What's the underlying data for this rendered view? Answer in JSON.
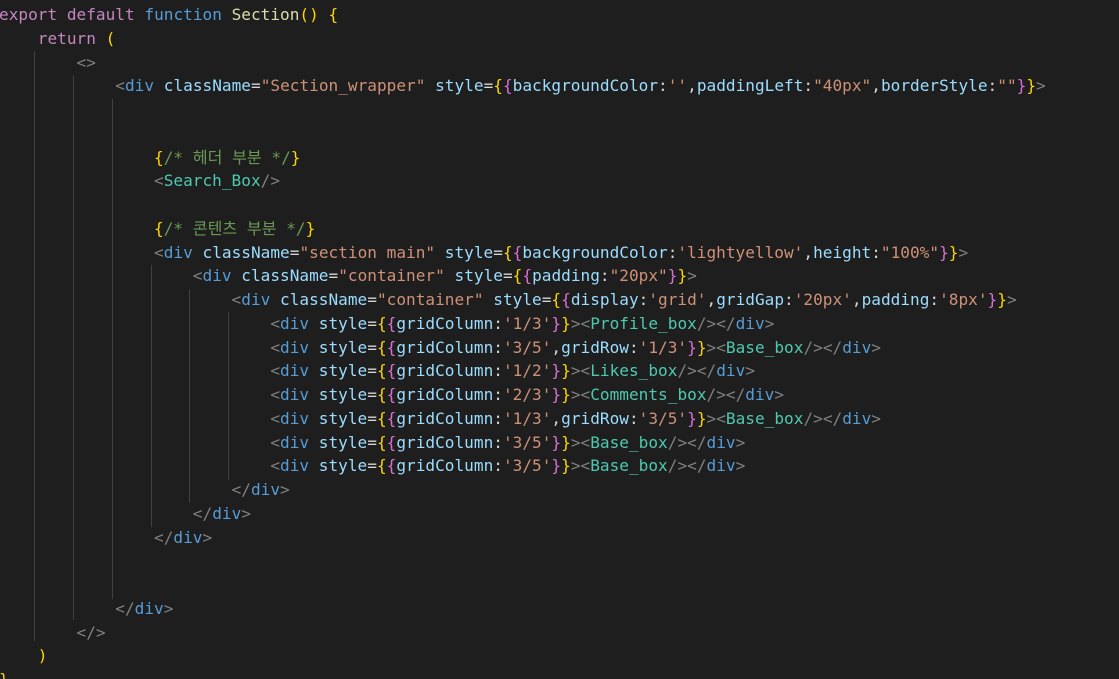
{
  "editor": {
    "language": "jsx",
    "theme_colors": {
      "background": "#1e1e1e",
      "keyword_control": "#c586c0",
      "keyword_storage": "#569cd6",
      "function": "#dcdcaa",
      "tag_punctuation": "#808080",
      "tag_name": "#569cd6",
      "component": "#4ec9b0",
      "attribute": "#9cdcfe",
      "string": "#ce9178",
      "comment": "#6a9955",
      "bracket_level_1": "#ffd700",
      "bracket_level_2": "#da70d6",
      "bracket_level_3": "#179fff"
    },
    "lines": [
      "export default function Section() {",
      "    return (",
      "        <>",
      "            <div className=\"Section_wrapper\" style={{backgroundColor:'',paddingLeft:\"40px\",borderStyle:\"\"}}>",
      "",
      "",
      "                {/* 헤더 부분 */}",
      "                <Search_Box/>",
      "",
      "                {/* 콘텐츠 부분 */}",
      "                <div className=\"section main\" style={{backgroundColor:'lightyellow',height:\"100%\"}}>",
      "                    <div className=\"container\" style={{padding:\"20px\"}}>",
      "                        <div className=\"container\" style={{display:'grid',gridGap:'20px',padding:'8px'}}>",
      "                            <div style={{gridColumn:'1/3'}}><Profile_box/></div>",
      "                            <div style={{gridColumn:'3/5',gridRow:'1/3'}}><Base_box/></div>",
      "                            <div style={{gridColumn:'1/2'}}><Likes_box/></div>",
      "                            <div style={{gridColumn:'2/3'}}><Comments_box/></div>",
      "                            <div style={{gridColumn:'1/3',gridRow:'3/5'}}><Base_box/></div>",
      "                            <div style={{gridColumn:'3/5'}}><Base_box/></div>",
      "                            <div style={{gridColumn:'3/5'}}><Base_box/></div>",
      "                        </div>",
      "                    </div>",
      "                </div>",
      "",
      "",
      "            </div>",
      "        </>",
      "    )",
      "}"
    ]
  }
}
